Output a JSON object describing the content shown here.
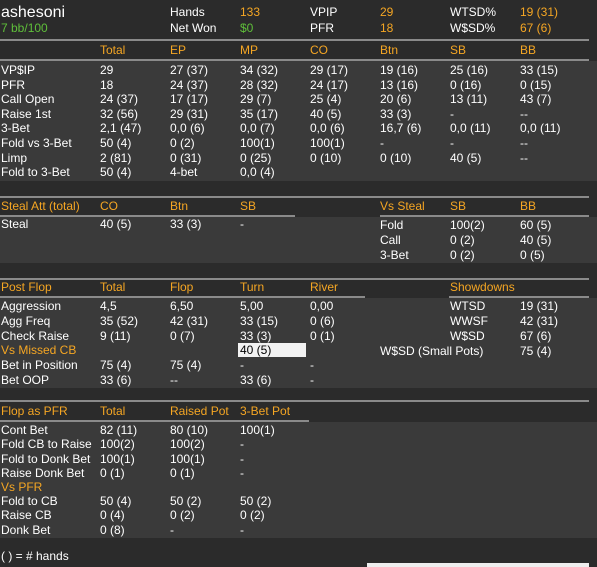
{
  "header": {
    "player": "ashesoni",
    "winrate": "7 bb/100",
    "hands_label": "Hands",
    "hands_value": "133",
    "netwon_label": "Net Won",
    "netwon_value": "$0",
    "vpip_label": "VPIP",
    "vpip_value": "29",
    "pfr_label": "PFR",
    "pfr_value": "18",
    "wtsd_label": "WTSD%",
    "wtsd_value": "19 (31)",
    "wsd_label": "W$SD%",
    "wsd_value": "67 (6)"
  },
  "preflop": {
    "columns": [
      "Total",
      "EP",
      "MP",
      "CO",
      "Btn",
      "SB",
      "BB"
    ],
    "rows": [
      {
        "label": "VP$IP",
        "vals": [
          "29",
          "27 (37)",
          "34 (32)",
          "29 (17)",
          "19 (16)",
          "25 (16)",
          "33 (15)"
        ]
      },
      {
        "label": "PFR",
        "vals": [
          "18",
          "24 (37)",
          "28 (32)",
          "24 (17)",
          "13 (16)",
          "0 (16)",
          "0 (15)"
        ]
      },
      {
        "label": "Call Open",
        "vals": [
          "24 (37)",
          "17 (17)",
          "29 (7)",
          "25 (4)",
          "20 (6)",
          "13 (11)",
          "43 (7)"
        ]
      },
      {
        "label": "Raise 1st",
        "vals": [
          "32 (56)",
          "29 (31)",
          "35 (17)",
          "40 (5)",
          "33 (3)",
          "-",
          "--"
        ]
      },
      {
        "label": "3-Bet",
        "vals": [
          "2,1 (47)",
          "0,0 (6)",
          "0,0 (7)",
          "0,0 (6)",
          "16,7 (6)",
          "0,0 (11)",
          "0,0 (11)"
        ]
      },
      {
        "label": "Fold vs 3-Bet",
        "vals": [
          "50 (4)",
          "0 (2)",
          "100(1)",
          "100(1)",
          "-",
          "-",
          "--"
        ]
      },
      {
        "label": "Limp",
        "vals": [
          "2 (81)",
          "0 (31)",
          "0 (25)",
          "0 (10)",
          "0 (10)",
          "40 (5)",
          "--"
        ]
      },
      {
        "label": "Fold to 3-Bet",
        "vals": [
          "50 (4)",
          "4-bet",
          "0,0 (4)",
          "",
          "",
          "",
          ""
        ]
      }
    ]
  },
  "steal": {
    "title": "Steal Att (total)",
    "cols": [
      "CO",
      "Btn",
      "SB"
    ],
    "row_label": "Steal",
    "row_vals": [
      "40 (5)",
      "33 (3)",
      "-"
    ],
    "vs_title": "Vs Steal",
    "vs_cols": [
      "SB",
      "BB"
    ],
    "vs_rows": [
      {
        "label": "Fold",
        "vals": [
          "100(2)",
          "60 (5)"
        ]
      },
      {
        "label": "Call",
        "vals": [
          "0 (2)",
          "40 (5)"
        ]
      },
      {
        "label": "3-Bet",
        "vals": [
          "0 (2)",
          "0 (5)"
        ]
      }
    ]
  },
  "postflop": {
    "title": "Post Flop",
    "cols": [
      "Total",
      "Flop",
      "Turn",
      "River"
    ],
    "rows": [
      {
        "label": "Aggression",
        "vals": [
          "4,5",
          "6,50",
          "5,00",
          "0,00"
        ]
      },
      {
        "label": "Agg Freq",
        "vals": [
          "35 (52)",
          "42 (31)",
          "33 (15)",
          "0 (6)"
        ]
      },
      {
        "label": "Check Raise",
        "vals": [
          "9 (11)",
          "0 (7)",
          "33 (3)",
          "0 (1)"
        ]
      }
    ],
    "missed_cb_label": "Vs Missed CB",
    "missed_cb_turn": "40 (5)",
    "rows2": [
      {
        "label": "Bet in Position",
        "vals": [
          "75 (4)",
          "75 (4)",
          "-",
          "-"
        ]
      },
      {
        "label": "Bet OOP",
        "vals": [
          "33 (6)",
          "--",
          "33 (6)",
          "-"
        ]
      }
    ],
    "showdowns_title": "Showdowns",
    "showdowns": [
      {
        "label": "WTSD",
        "val": "19 (31)"
      },
      {
        "label": "WWSF",
        "val": "42 (31)"
      },
      {
        "label": "W$SD",
        "val": "67 (6)"
      },
      {
        "label": "W$SD (Small Pots)",
        "val": "75 (4)"
      }
    ]
  },
  "pfr": {
    "title": "Flop as PFR",
    "cols": [
      "Total",
      "Raised Pot",
      "3-Bet Pot"
    ],
    "rows": [
      {
        "label": "Cont Bet",
        "vals": [
          "82 (11)",
          "80 (10)",
          "100(1)"
        ]
      },
      {
        "label": "Fold CB to Raise",
        "vals": [
          "100(2)",
          "100(2)",
          "-"
        ]
      },
      {
        "label": "Fold to Donk Bet",
        "vals": [
          "100(1)",
          "100(1)",
          "-"
        ]
      },
      {
        "label": "Raise Donk Bet",
        "vals": [
          "0 (1)",
          "0 (1)",
          "-"
        ]
      }
    ],
    "vs_title": "Vs PFR",
    "vs_rows": [
      {
        "label": "Fold to CB",
        "vals": [
          "50 (4)",
          "50 (2)",
          "50 (2)"
        ]
      },
      {
        "label": "Raise CB",
        "vals": [
          "0 (4)",
          "0 (2)",
          "0 (2)"
        ]
      },
      {
        "label": "Donk Bet",
        "vals": [
          "0 (8)",
          "-",
          "-"
        ]
      }
    ]
  },
  "footer": "( ) = # hands"
}
